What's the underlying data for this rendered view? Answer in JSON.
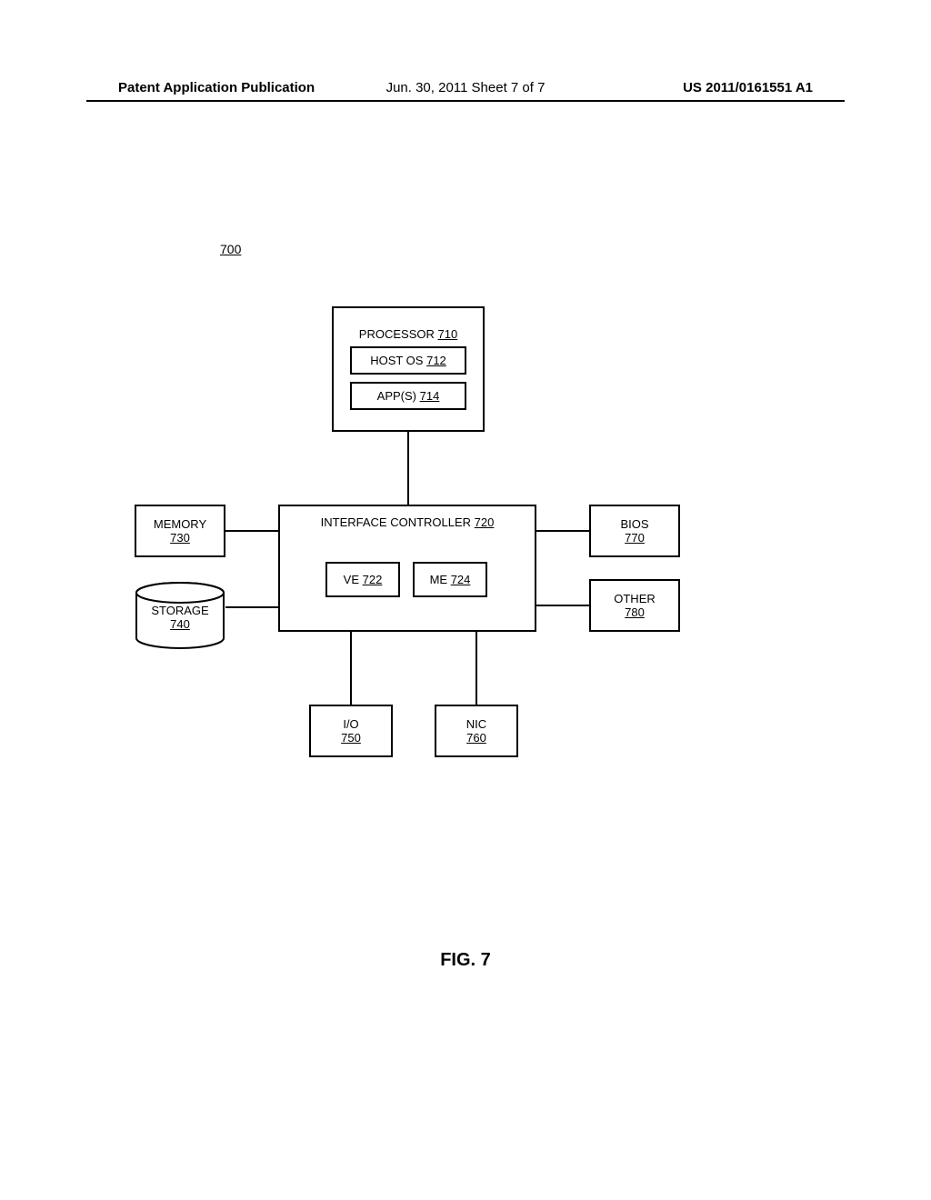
{
  "header": {
    "left": "Patent Application Publication",
    "center": "Jun. 30, 2011  Sheet 7 of 7",
    "right": "US 2011/0161551 A1"
  },
  "diagram": {
    "ref": "700",
    "processor": {
      "label": "PROCESSOR",
      "num": "710",
      "hostos_label": "HOST OS",
      "hostos_num": "712",
      "apps_label": "APP(S)",
      "apps_num": "714"
    },
    "interface": {
      "label": "INTERFACE CONTROLLER",
      "num": "720",
      "ve_label": "VE",
      "ve_num": "722",
      "me_label": "ME",
      "me_num": "724"
    },
    "memory": {
      "label": "MEMORY",
      "num": "730"
    },
    "storage": {
      "label": "STORAGE",
      "num": "740"
    },
    "io": {
      "label": "I/O",
      "num": "750"
    },
    "nic": {
      "label": "NIC",
      "num": "760"
    },
    "bios": {
      "label": "BIOS",
      "num": "770"
    },
    "other": {
      "label": "OTHER",
      "num": "780"
    }
  },
  "figure": "FIG. 7"
}
